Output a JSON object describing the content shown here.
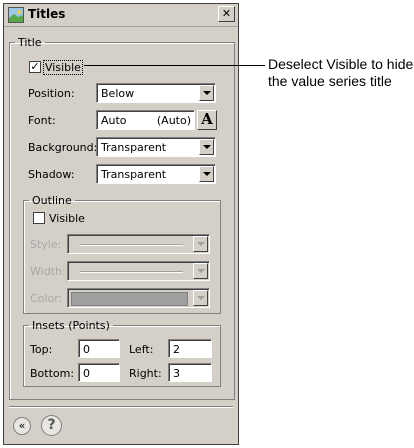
{
  "dialog": {
    "title": "Titles",
    "close_label": "✕",
    "collapse_label": "«",
    "help_label": "?"
  },
  "title_group": {
    "legend": "Title",
    "visible": {
      "label": "Visible",
      "checked": true,
      "mark": "✓"
    },
    "position": {
      "label": "Position:",
      "value": "Below"
    },
    "font": {
      "label": "Font:",
      "value": "Auto",
      "size": "(Auto)",
      "button_label": "A"
    },
    "background": {
      "label": "Background:",
      "value": "Transparent"
    },
    "shadow": {
      "label": "Shadow:",
      "value": "Transparent"
    }
  },
  "outline_group": {
    "legend": "Outline",
    "visible": {
      "label": "Visible",
      "checked": false
    },
    "style_label": "Style:",
    "width_label": "Width:",
    "color_label": "Color:"
  },
  "insets_group": {
    "legend": "Insets (Points)",
    "top": {
      "label": "Top:",
      "value": "0"
    },
    "left": {
      "label": "Left:",
      "value": "2"
    },
    "bottom": {
      "label": "Bottom:",
      "value": "0"
    },
    "right": {
      "label": "Right:",
      "value": "3"
    }
  },
  "callout": {
    "text": "Deselect Visible to hide the value series title"
  },
  "colors": {
    "dialog_face": "#d4d0c8",
    "disabled_text": "#a8a8a8",
    "icon_sky": "#9cc7e8",
    "icon_grass": "#5aa84a"
  }
}
